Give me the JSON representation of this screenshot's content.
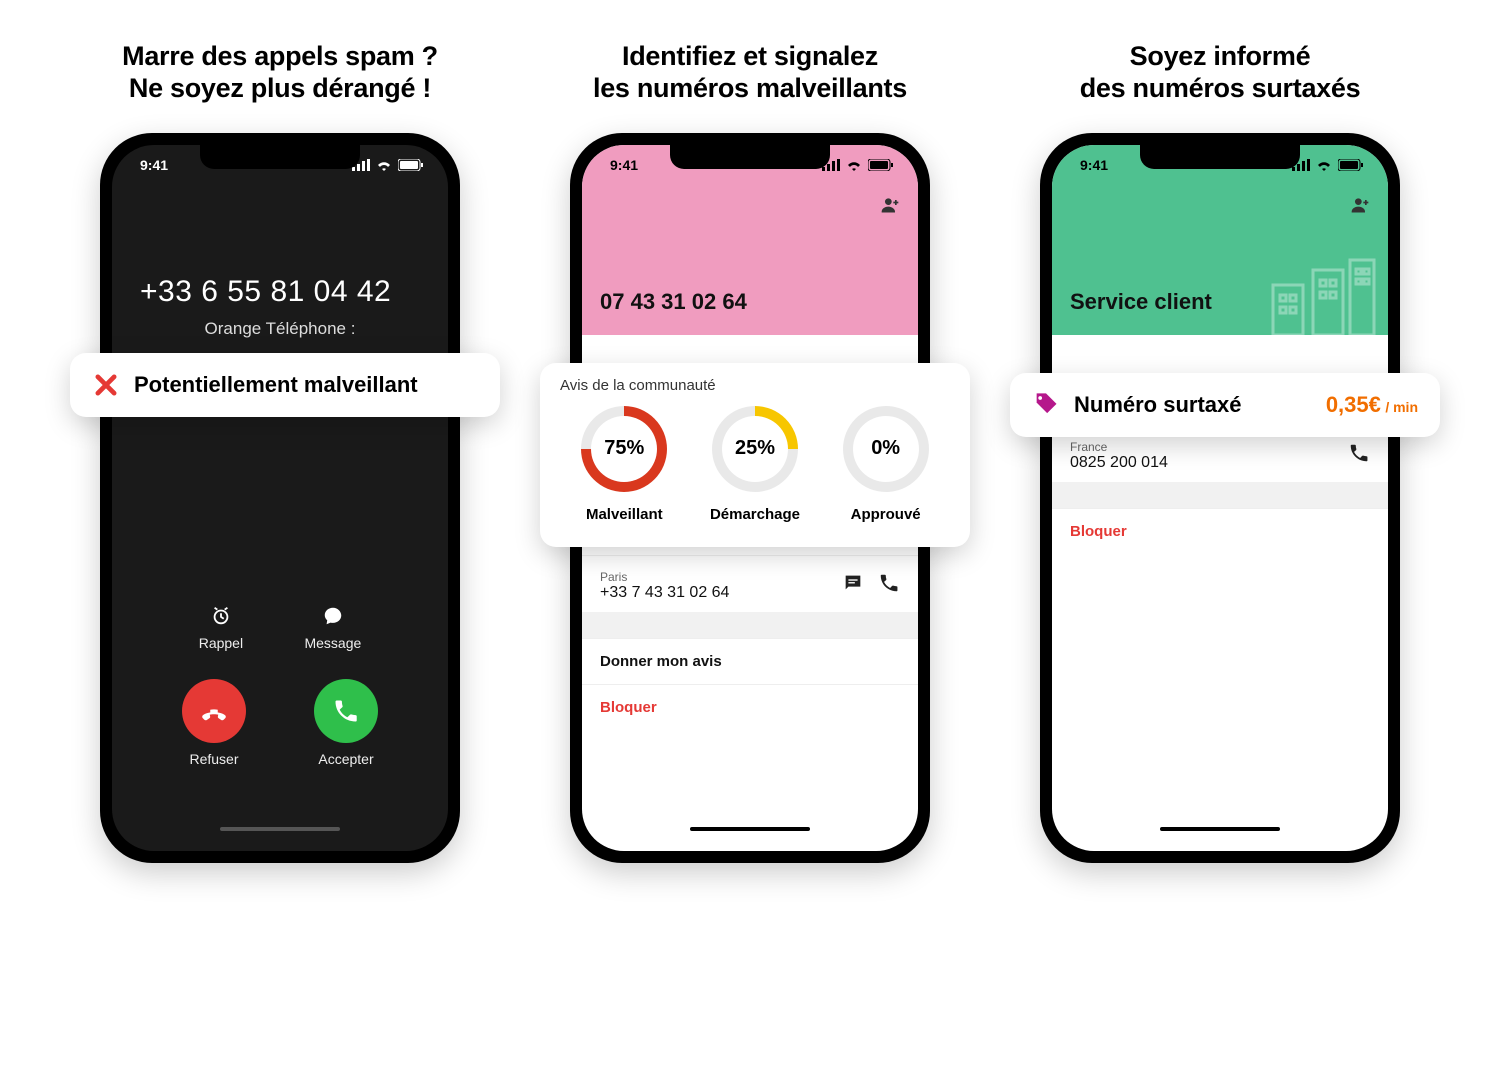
{
  "status_time": "9:41",
  "panels": {
    "p1": {
      "headline_l1": "Marre des appels spam ?",
      "headline_l2": "Ne soyez plus dérangé !",
      "phone_number": "+33 6 55 81 04 42",
      "subtitle": "Orange Téléphone :",
      "callout_text": "Potentiellement malveillant",
      "mini": {
        "remind": "Rappel",
        "message": "Message"
      },
      "actions": {
        "decline": "Refuser",
        "accept": "Accepter"
      }
    },
    "p2": {
      "headline_l1": "Identifiez et signalez",
      "headline_l2": "les numéros malveillants",
      "short_number": "07 43 31 02 64",
      "detail_city": "Paris",
      "detail_number": "+33 7 43 31 02 64",
      "give_opinion": "Donner mon avis",
      "block": "Bloquer",
      "callout_title": "Avis de la communauté",
      "donuts": {
        "malicious": {
          "pct": "75%",
          "label": "Malveillant",
          "value": 75,
          "color": "#d9381e"
        },
        "telemarket": {
          "pct": "25%",
          "label": "Démarchage",
          "value": 25,
          "color": "#f7c600"
        },
        "approved": {
          "pct": "0%",
          "label": "Approuvé",
          "value": 0,
          "color": "#bbb"
        }
      }
    },
    "p3": {
      "headline_l1": "Soyez informé",
      "headline_l2": "des numéros surtaxés",
      "header_title": "Service client",
      "detail_country": "France",
      "detail_number": "0825 200 014",
      "block": "Bloquer",
      "callout_text": "Numéro surtaxé",
      "price": "0,35€",
      "unit": "/ min"
    }
  },
  "chart_data": {
    "type": "pie",
    "title": "Avis de la communauté",
    "categories": [
      "Malveillant",
      "Démarchage",
      "Approuvé"
    ],
    "values": [
      75,
      25,
      0
    ],
    "colors": [
      "#d9381e",
      "#f7c600",
      "#cccccc"
    ]
  }
}
